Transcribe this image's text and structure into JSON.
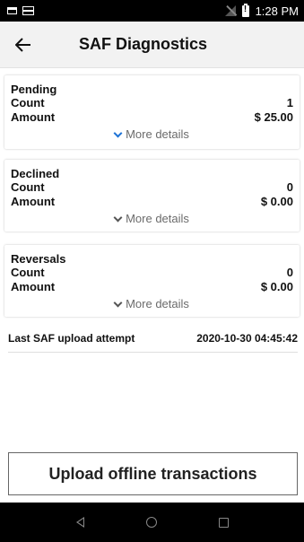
{
  "status_bar": {
    "time": "1:28 PM",
    "icons": [
      "notification-icon",
      "card-icon",
      "no-signal-icon",
      "battery-alert-icon"
    ]
  },
  "app_bar": {
    "back_icon": "arrow-left-icon",
    "title": "SAF Diagnostics"
  },
  "cards": [
    {
      "title": "Pending",
      "count_label": "Count",
      "count_value": "1",
      "amount_label": "Amount",
      "amount_value": "$ 25.00",
      "more_details": "More details",
      "chevron_color": "#1e73d6"
    },
    {
      "title": "Declined",
      "count_label": "Count",
      "count_value": "0",
      "amount_label": "Amount",
      "amount_value": "$ 0.00",
      "more_details": "More details",
      "chevron_color": "#555555"
    },
    {
      "title": "Reversals",
      "count_label": "Count",
      "count_value": "0",
      "amount_label": "Amount",
      "amount_value": "$ 0.00",
      "more_details": "More details",
      "chevron_color": "#555555"
    }
  ],
  "last_upload": {
    "label": "Last SAF upload attempt",
    "value": "2020-10-30 04:45:42"
  },
  "upload_button": {
    "label": "Upload offline transactions"
  },
  "nav_bar": {
    "icons": [
      "back-triangle-icon",
      "home-circle-icon",
      "recents-square-icon"
    ]
  }
}
